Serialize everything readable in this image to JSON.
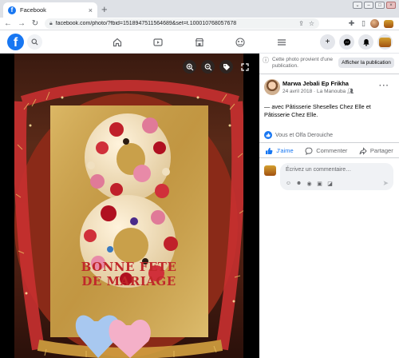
{
  "browser": {
    "tab_title": "Facebook",
    "url": "facebook.com/photo/?fbid=1518947511564689&set=t.100010768057678"
  },
  "photo_overlay_text": {
    "line1": "BONNE  FETE",
    "line2": "DE MARIAGE"
  },
  "panel": {
    "notice": "Cette photo provient d'une publication.",
    "show_post_button": "Afficher la publication",
    "author": "Marwa Jebali Ep Frikha",
    "date": "24 avril 2018",
    "location": "La Manouba",
    "post_text": "— avec Pâtisserie Sheselles Chez Elle et Pâtisserie Chez Elle.",
    "reactions": "Vous et Olfa Derouiche",
    "actions": {
      "like": "J'aime",
      "comment": "Commenter",
      "share": "Partager"
    },
    "comment_placeholder": "Écrivez un commentaire…"
  },
  "colors": {
    "facebook_blue": "#1877f2",
    "cake_text_red": "#c0282a"
  }
}
